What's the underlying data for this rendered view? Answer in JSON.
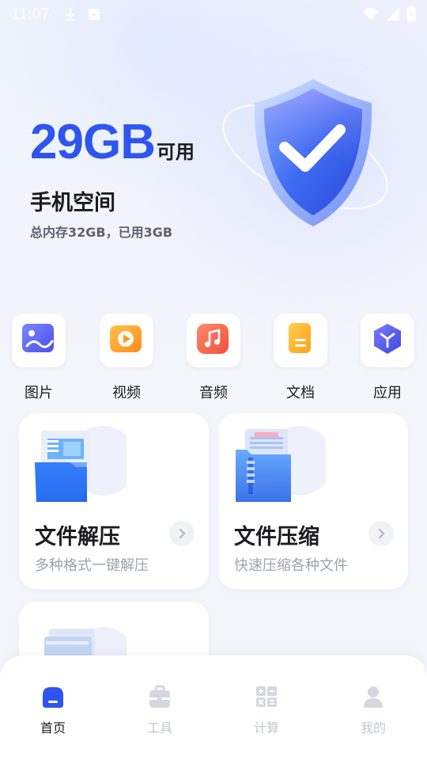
{
  "status_bar": {
    "time": "11:07",
    "icons": [
      "download-icon",
      "media-icon",
      "wifi-icon",
      "signal-icon",
      "battery-icon"
    ]
  },
  "storage": {
    "amount": "29GB",
    "available_label": "可用",
    "title": "手机空间",
    "detail": "总内存32GB，已用3GB",
    "illustration": "shield-check-icon"
  },
  "categories": [
    {
      "label": "图片",
      "icon": "image-icon"
    },
    {
      "label": "视频",
      "icon": "video-icon"
    },
    {
      "label": "音频",
      "icon": "music-icon"
    },
    {
      "label": "文档",
      "icon": "document-icon"
    },
    {
      "label": "应用",
      "icon": "app-cube-icon"
    }
  ],
  "features": [
    {
      "title": "文件解压",
      "subtitle": "多种格式一键解压",
      "icon": "folder-extract-icon"
    },
    {
      "title": "文件压缩",
      "subtitle": "快速压缩各种文件",
      "icon": "folder-compress-icon"
    },
    {
      "title": "",
      "subtitle": "",
      "icon": "file-clean-icon"
    }
  ],
  "bottom_nav": [
    {
      "label": "首页",
      "icon": "home-icon",
      "active": true
    },
    {
      "label": "工具",
      "icon": "toolbox-icon",
      "active": false
    },
    {
      "label": "计算",
      "icon": "calculator-icon",
      "active": false
    },
    {
      "label": "我的",
      "icon": "profile-icon",
      "active": false
    }
  ],
  "colors": {
    "accent": "#2f55f0",
    "nav_active": "#2f55f0",
    "nav_inactive": "#d5d8de"
  }
}
